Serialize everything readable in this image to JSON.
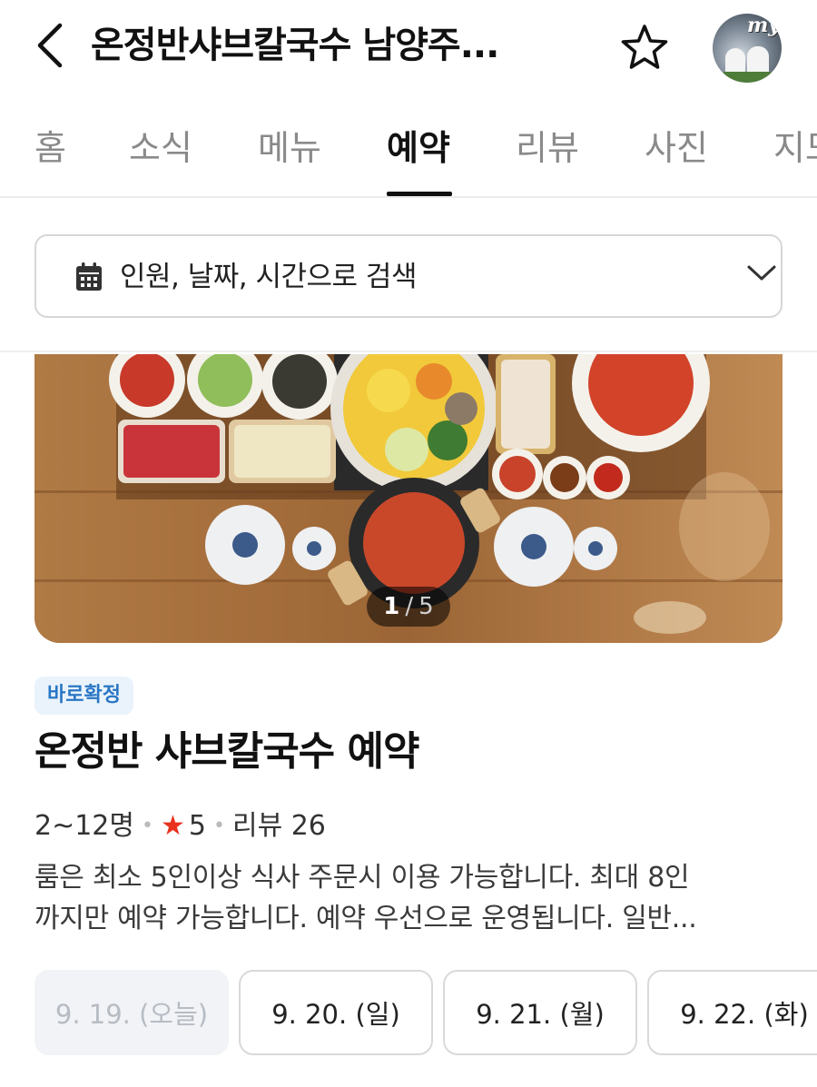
{
  "header": {
    "back_icon": "chevron-left-icon",
    "title": "온정반샤브칼국수 남양주...",
    "favorite_icon": "star-outline-icon",
    "avatar_text": "my"
  },
  "tabs": [
    {
      "label": "홈",
      "active": false
    },
    {
      "label": "소식",
      "active": false
    },
    {
      "label": "메뉴",
      "active": false
    },
    {
      "label": "예약",
      "active": true
    },
    {
      "label": "리뷰",
      "active": false
    },
    {
      "label": "사진",
      "active": false
    },
    {
      "label": "지도",
      "active": false
    }
  ],
  "search": {
    "icon": "calendar-icon",
    "label": "인원, 날짜, 시간으로 검색",
    "dropdown_icon": "chevron-down-icon"
  },
  "photo": {
    "current": "1",
    "separator": "/",
    "total": "5"
  },
  "product": {
    "badge": "바로확정",
    "title": "온정반 샤브칼국수 예약",
    "capacity": "2~12명",
    "rating": "5",
    "reviews": "리뷰 26",
    "description_line1": "룸은 최소 5인이상 식사 주문시 이용 가능합니다. 최대 8인",
    "description_line2": "까지만 예약 가능합니다. 예약 우선으로 운영됩니다. 일반..."
  },
  "dates": [
    {
      "label": "9. 19. (오늘)",
      "disabled": true
    },
    {
      "label": "9. 20. (일)",
      "disabled": false
    },
    {
      "label": "9. 21. (월)",
      "disabled": false
    },
    {
      "label": "9. 22. (화)",
      "disabled": false
    }
  ],
  "colors": {
    "accent_blue": "#2a77c4",
    "badge_bg": "#eaf3fb",
    "star_red": "#e8321e",
    "active_tab": "#111111",
    "inactive_tab": "#8a8a8a"
  }
}
